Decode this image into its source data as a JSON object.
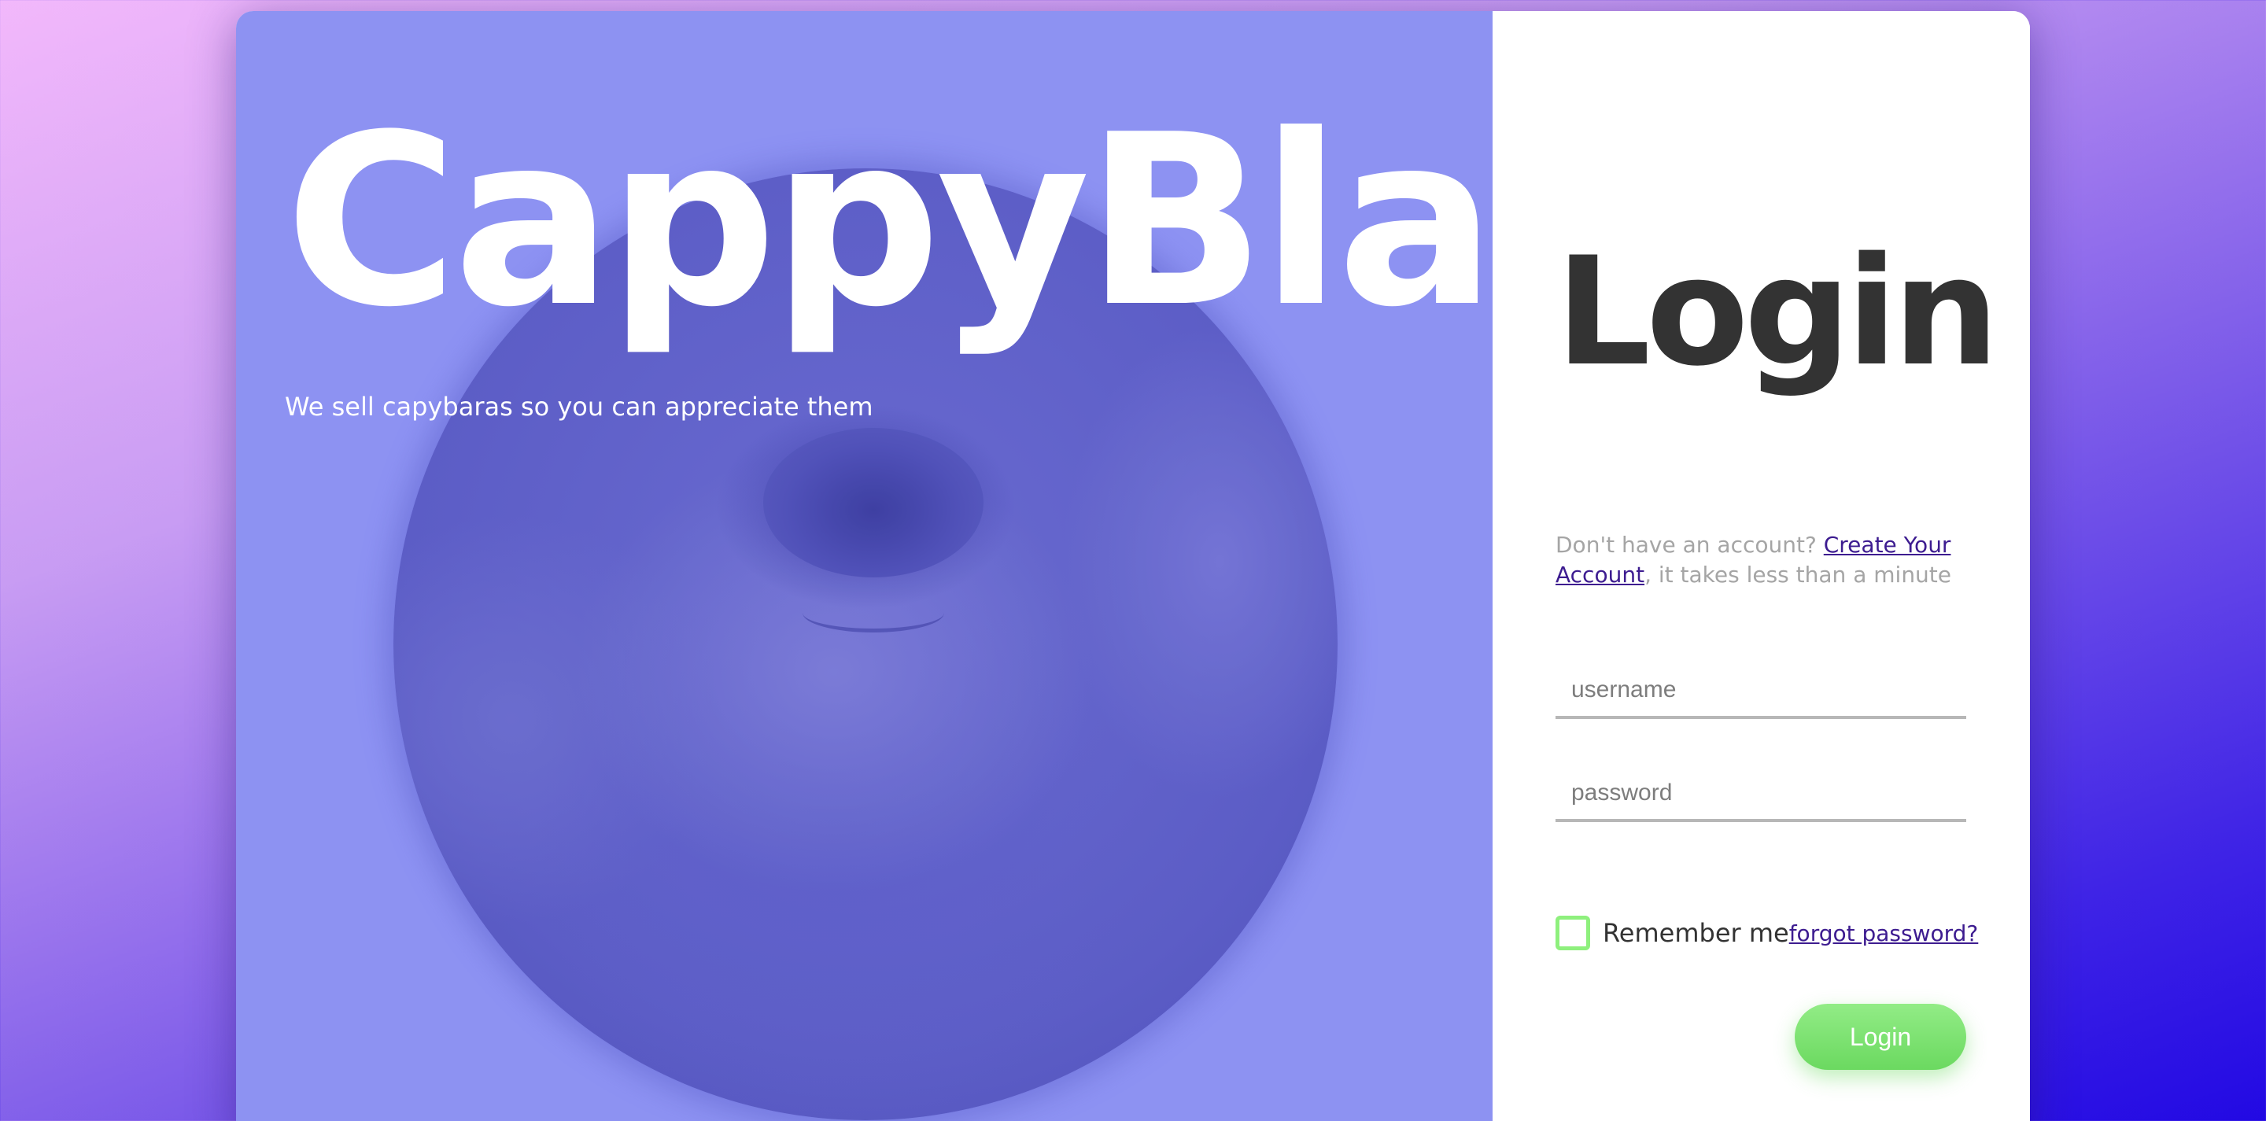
{
  "hero": {
    "title": "CappyBlapp",
    "tagline": "We sell capybaras so you can appreciate them",
    "photo_icon": "capybara-photo"
  },
  "login": {
    "title": "Login",
    "signup_prompt_prefix": "Don't have an account? ",
    "signup_link": "Create Your Account",
    "signup_prompt_suffix": ", it takes less than a minute",
    "username_placeholder": "username",
    "password_placeholder": "password",
    "remember_label": "Remember me",
    "forgot_link": "forgot password?",
    "submit_label": "Login"
  },
  "colors": {
    "hero_overlay": "#8d92f2",
    "accent_green": "#7be36f",
    "link_purple": "#3d1c90",
    "title_dark": "#333333"
  }
}
